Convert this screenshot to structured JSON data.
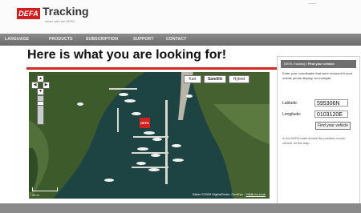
{
  "logo": {
    "brand": "DEFA",
    "name": "Tracking",
    "tagline": "better with the DEFA"
  },
  "nav": {
    "items": [
      "LANGUAGE",
      "PRODUCTS",
      "SUBSCRIPTION",
      "SUPPORT",
      "CONTACT"
    ]
  },
  "main": {
    "headline": "Here is what you are looking for!"
  },
  "map": {
    "buttons": [
      "Kart",
      "Satellitt",
      "Hybrid"
    ],
    "active_button": "Satellitt",
    "marker_label": "DEFA",
    "scale_label": "20 m",
    "attribution": "Bilder ©2009 DigitalGlobe, GeoEye -",
    "attribution_link": "Vilkår for bruk"
  },
  "panel": {
    "title_prefix": "DEFA Tracking /",
    "title_bold": "Find your vehicle",
    "intro": "Enter your coordinates that were returned to your mobile phone display, for example:",
    "latitude_label": "Latitude:",
    "latitude_value": "595306N",
    "longitude_label": "Longitude:",
    "longitude_value": "0103120E",
    "find_button": "Find your vehicle",
    "note": "A red DEFA-mark shows the position of your vehicle on the map."
  },
  "colors": {
    "accent": "#d12a2a",
    "nav_bg": "#7a7a7a",
    "panel_title_bg": "#6f6f6f"
  }
}
